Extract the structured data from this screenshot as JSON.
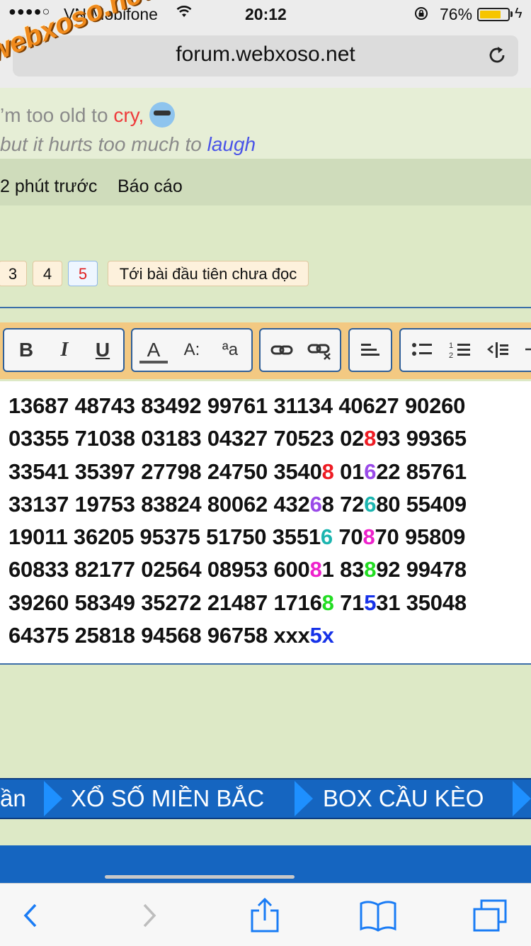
{
  "status": {
    "signal": "●●●●○",
    "carrier": "VN Mobifone",
    "time": "20:12",
    "battery": "76%",
    "battery_level": 0.76
  },
  "browser": {
    "url": "forum.webxoso.net",
    "watermark": "webxoso.net"
  },
  "signature": {
    "line1_pre": "’m too old to ",
    "line1_red": "cry,",
    "line2_pre": "but it hurts too much to ",
    "line2_blue": "laugh"
  },
  "post_meta": {
    "time": "2 phút trước",
    "report": "Báo cáo"
  },
  "pagination": {
    "pages": [
      "3",
      "4",
      "5"
    ],
    "current": "5",
    "first_unread": "Tới bài đầu tiên chưa đọc"
  },
  "toolbar": {
    "bold": "B",
    "italic": "I",
    "underline": "U",
    "font_color": "A",
    "font_size": "A:",
    "font_family": "ªa"
  },
  "editor": {
    "lines": [
      [
        [
          "13687 48743 83492 99761 31134 40627 90260",
          ""
        ]
      ],
      [
        [
          "03355 71038 03183 04327 70523 02",
          ""
        ],
        [
          "8",
          "red"
        ],
        [
          "93 99365",
          ""
        ]
      ],
      [
        [
          "33541 35397 27798 24750 3540",
          ""
        ],
        [
          "8",
          "red"
        ],
        [
          " 01",
          ""
        ],
        [
          "6",
          "purple"
        ],
        [
          "22 85761",
          ""
        ]
      ],
      [
        [
          "33137 19753 83824 80062 432",
          ""
        ],
        [
          "6",
          "purple"
        ],
        [
          "8 72",
          ""
        ],
        [
          "6",
          "teal"
        ],
        [
          "80 55409",
          ""
        ]
      ],
      [
        [
          "19011 36205 95375 51750 3551",
          ""
        ],
        [
          "6",
          "teal"
        ],
        [
          " 70",
          ""
        ],
        [
          "8",
          "pink"
        ],
        [
          "70 95809",
          ""
        ]
      ],
      [
        [
          "60833 82177 02564 08953 600",
          ""
        ],
        [
          "8",
          "pink"
        ],
        [
          "1 83",
          ""
        ],
        [
          "8",
          "green"
        ],
        [
          "92 99478",
          ""
        ]
      ],
      [
        [
          "39260 58349 35272 21487 1716",
          ""
        ],
        [
          "8",
          "green"
        ],
        [
          " 71",
          ""
        ],
        [
          "5",
          "blue"
        ],
        [
          "31 35048",
          ""
        ]
      ],
      [
        [
          "64375 25818 94568 96758 xxx",
          ""
        ],
        [
          "5x",
          "blue"
        ]
      ]
    ]
  },
  "forum_nav": {
    "items": [
      "ần",
      "XỔ SỐ MIỀN BẮC",
      "BOX CẦU KÈO"
    ]
  },
  "safari": {
    "icons": [
      "back-icon",
      "forward-icon",
      "share-icon",
      "bookmarks-icon",
      "tabs-icon"
    ]
  },
  "colors": {
    "page_bg": "#dde9c6",
    "nav_blue": "#1565c0",
    "toolbar_bg": "#f3c982"
  }
}
